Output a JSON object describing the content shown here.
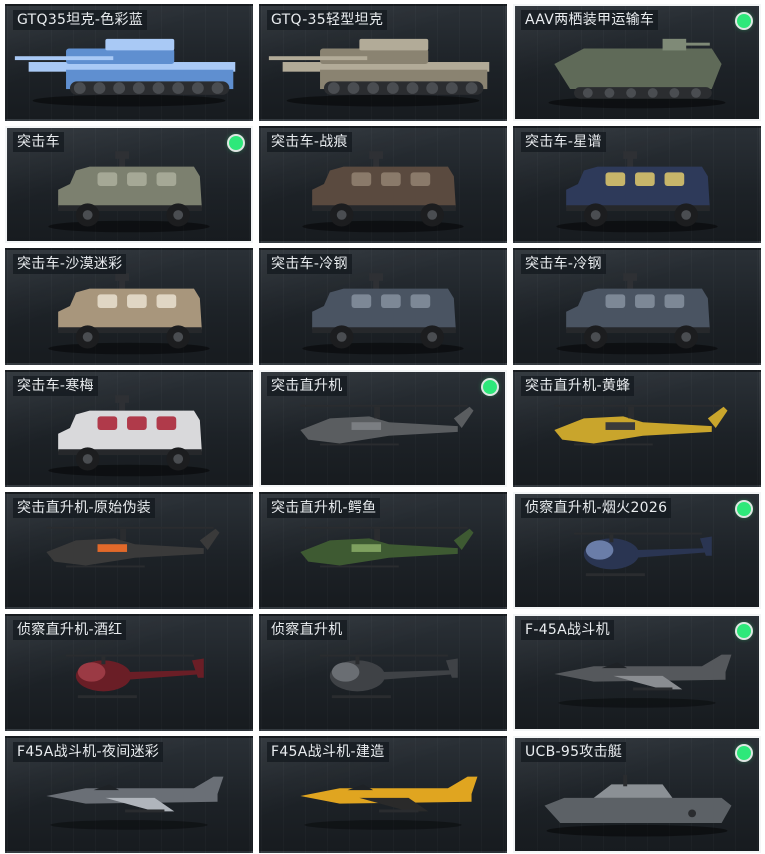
{
  "items": [
    {
      "name": "GTQ35坦克-色彩蓝",
      "type": "tank",
      "color": "#5f8fd0",
      "accent": "#a9c9f5",
      "selected": false,
      "equipped": false
    },
    {
      "name": "GTQ-35轻型坦克",
      "type": "tank",
      "color": "#8a8371",
      "accent": "#b2ab98",
      "selected": false,
      "equipped": false
    },
    {
      "name": "AAV两栖装甲运输车",
      "type": "aav",
      "color": "#5f6a58",
      "accent": "#7f8a77",
      "selected": true,
      "equipped": true
    },
    {
      "name": "突击车",
      "type": "truck",
      "color": "#7c806f",
      "accent": "#a5a896",
      "selected": true,
      "equipped": true
    },
    {
      "name": "突击车-战痕",
      "type": "truck",
      "color": "#5a4a3f",
      "accent": "#8a7a6a",
      "selected": false,
      "equipped": false
    },
    {
      "name": "突击车-星谱",
      "type": "truck",
      "color": "#2e3a5a",
      "accent": "#c7b56a",
      "selected": false,
      "equipped": false
    },
    {
      "name": "突击车-沙漠迷彩",
      "type": "truck",
      "color": "#a8967c",
      "accent": "#e0d6c4",
      "selected": false,
      "equipped": false
    },
    {
      "name": "突击车-冷钢",
      "type": "truck",
      "color": "#4a5462",
      "accent": "#7d8896",
      "selected": false,
      "equipped": false
    },
    {
      "name": "突击车-冷钢",
      "type": "truck",
      "color": "#4a5462",
      "accent": "#7d8896",
      "selected": false,
      "equipped": false
    },
    {
      "name": "突击车-寒梅",
      "type": "truck",
      "color": "#d9d9db",
      "accent": "#b03a4a",
      "selected": false,
      "equipped": false
    },
    {
      "name": "突击直升机",
      "type": "heli",
      "color": "#5a5d60",
      "accent": "#7b7e82",
      "selected": true,
      "equipped": true
    },
    {
      "name": "突击直升机-黄蜂",
      "type": "heli",
      "color": "#c9a52c",
      "accent": "#3a3a3a",
      "selected": false,
      "equipped": false
    },
    {
      "name": "突击直升机-原始伪装",
      "type": "heli",
      "color": "#3a3a3a",
      "accent": "#e2692a",
      "selected": false,
      "equipped": false
    },
    {
      "name": "突击直升机-鳄鱼",
      "type": "heli",
      "color": "#3e5a32",
      "accent": "#7ea05f",
      "selected": false,
      "equipped": false
    },
    {
      "name": "侦察直升机-烟火2026",
      "type": "scout",
      "color": "#2a3552",
      "accent": "#6a7da8",
      "selected": true,
      "equipped": true
    },
    {
      "name": "侦察直升机-酒红",
      "type": "scout",
      "color": "#6a1e26",
      "accent": "#9b3a44",
      "selected": false,
      "equipped": false
    },
    {
      "name": "侦察直升机",
      "type": "scout",
      "color": "#3f4246",
      "accent": "#6a6e73",
      "selected": false,
      "equipped": false
    },
    {
      "name": "F-45A战斗机",
      "type": "jet",
      "color": "#55585c",
      "accent": "#8a8d91",
      "selected": true,
      "equipped": true
    },
    {
      "name": "F45A战斗机-夜间迷彩",
      "type": "jet",
      "color": "#6a6f76",
      "accent": "#b0b5bc",
      "selected": false,
      "equipped": false
    },
    {
      "name": "F45A战斗机-建造",
      "type": "jet",
      "color": "#e0a520",
      "accent": "#2a2a2a",
      "selected": false,
      "equipped": false
    },
    {
      "name": "UCB-95攻击艇",
      "type": "boat",
      "color": "#5c6166",
      "accent": "#8b9095",
      "selected": true,
      "equipped": true
    }
  ]
}
